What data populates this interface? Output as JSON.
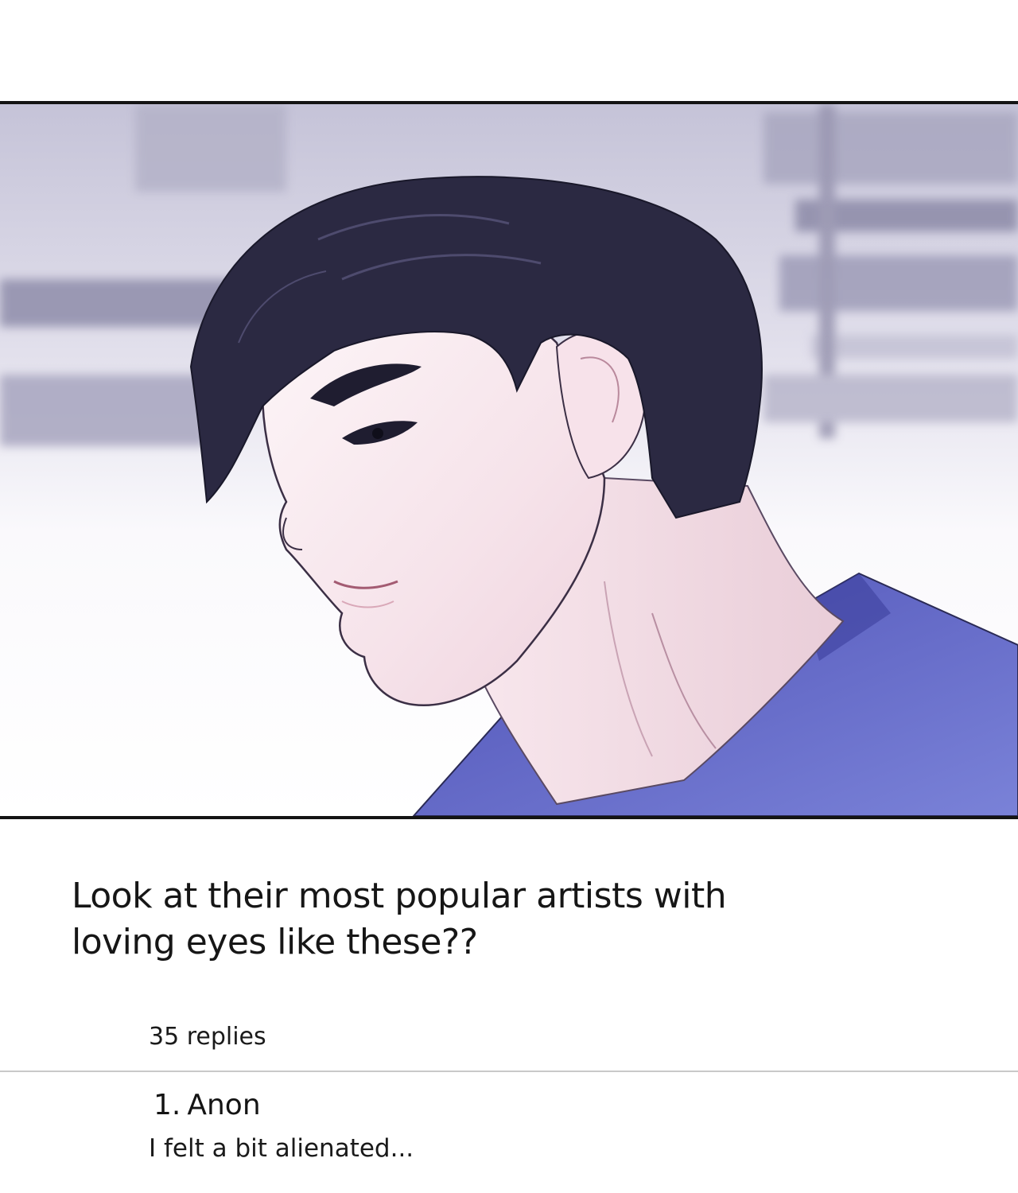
{
  "post": {
    "text_line_1": "Look at their most popular artists with",
    "text_line_2": "loving eyes like these??",
    "reply_count": "35 replies"
  },
  "replies": [
    {
      "index": "1.",
      "author": "Anon",
      "text": "I felt a bit alienated..."
    }
  ],
  "colors": {
    "panel_border": "#141414",
    "hair": "#2a2840",
    "skin": "#f7e9ef",
    "shirt": "#5a60c0",
    "divider": "#c9c9c9"
  }
}
